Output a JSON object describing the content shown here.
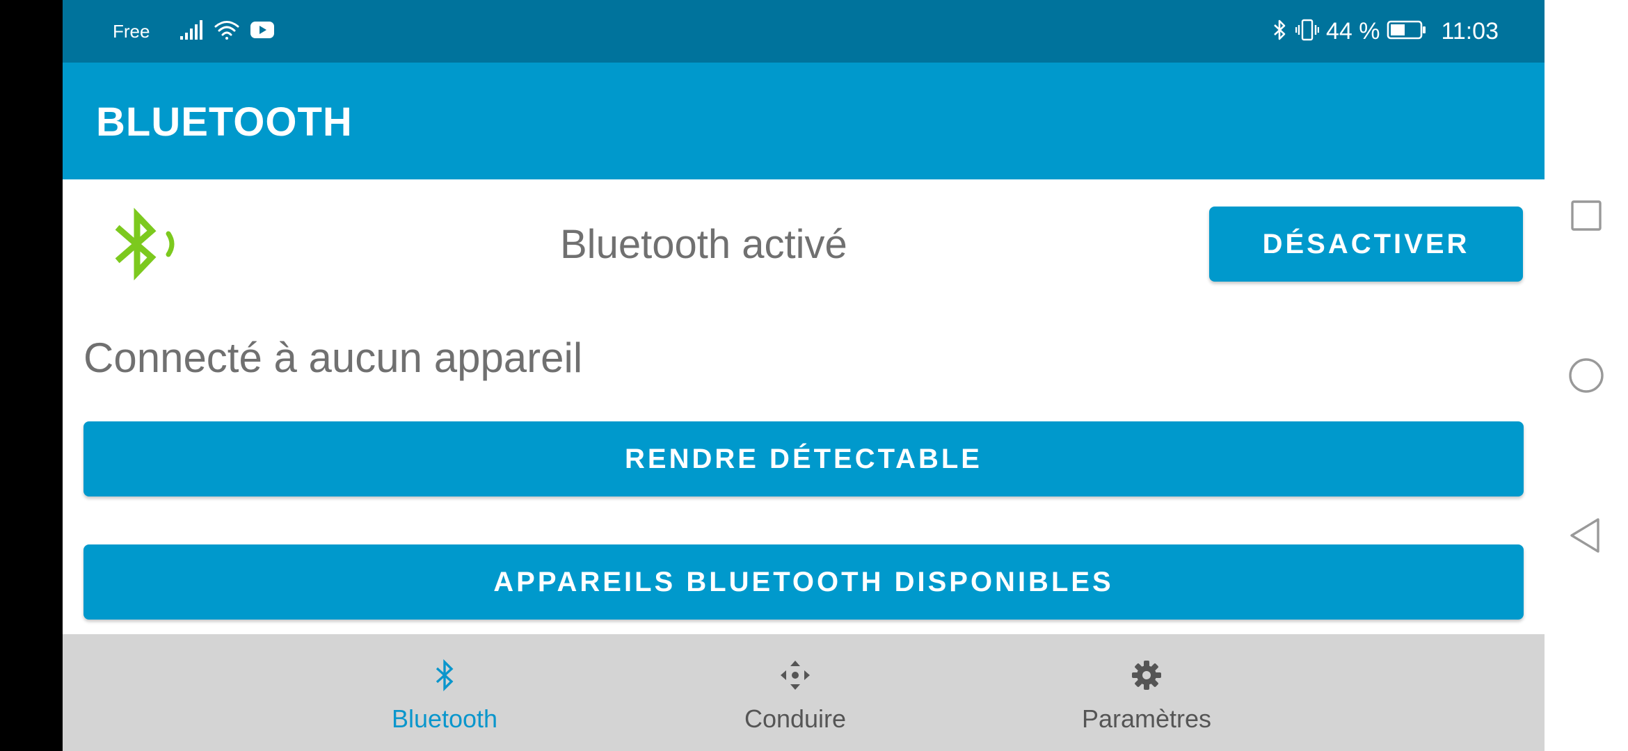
{
  "status_bar": {
    "carrier": "Free",
    "battery": "44 %",
    "time": "11:03",
    "icons": [
      "signal-icon",
      "wifi-icon",
      "youtube-icon",
      "bluetooth-icon",
      "vibrate-icon",
      "battery-icon"
    ]
  },
  "app_bar": {
    "title": "BLUETOOTH"
  },
  "bluetooth": {
    "status": "Bluetooth activé",
    "toggle_label": "DÉSACTIVER",
    "connection_status": "Connecté à aucun appareil",
    "discoverable_label": "RENDRE DÉTECTABLE",
    "available_devices_label": "APPAREILS BLUETOOTH DISPONIBLES",
    "logo_color": "#7cc91e"
  },
  "bottom_nav": {
    "items": [
      {
        "label": "Bluetooth",
        "icon": "bluetooth-icon",
        "active": true
      },
      {
        "label": "Conduire",
        "icon": "move-arrows-icon",
        "active": false
      },
      {
        "label": "Paramètres",
        "icon": "gear-icon",
        "active": false
      }
    ]
  },
  "system_nav": {
    "buttons": [
      "recents-square",
      "home-circle",
      "back-triangle"
    ]
  },
  "colors": {
    "status_bar": "#00739c",
    "primary": "#0099cc",
    "accent_active": "#0a96cc",
    "bottom_nav_bg": "#d4d4d4",
    "text_gray": "#707070"
  }
}
